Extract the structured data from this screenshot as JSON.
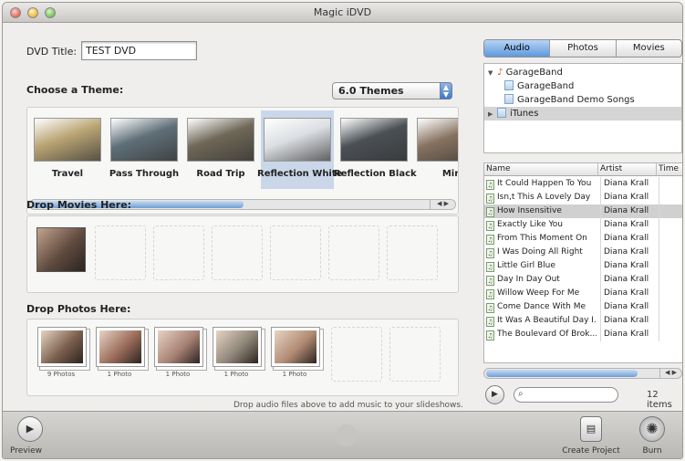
{
  "window": {
    "title": "Magic iDVD"
  },
  "dvd": {
    "label": "DVD Title:",
    "value": "TEST DVD"
  },
  "themes": {
    "heading": "Choose a Theme:",
    "selector_value": "6.0 Themes",
    "items": [
      {
        "label": "Travel",
        "color": "#b9a473"
      },
      {
        "label": "Pass Through",
        "color": "#5f6f78"
      },
      {
        "label": "Road Trip",
        "color": "#6f6757"
      },
      {
        "label": "Reflection White",
        "color": "#dcdfe3"
      },
      {
        "label": "Reflection Black",
        "color": "#4b5055"
      },
      {
        "label": "Mir",
        "color": "#86725f"
      }
    ],
    "selected_index": 3,
    "scroll_position": 0.55
  },
  "movies": {
    "heading": "Drop Movies Here:"
  },
  "photos": {
    "heading": "Drop Photos Here:",
    "items": [
      {
        "count": "9 Photos",
        "color": "#7b5f4d"
      },
      {
        "count": "1 Photo",
        "color": "#9a6b5a"
      },
      {
        "count": "1 Photo",
        "color": "#a88275"
      },
      {
        "count": "1 Photo",
        "color": "#8e8578"
      },
      {
        "count": "1 Photo",
        "color": "#b08a73"
      }
    ],
    "hint": "Drop audio files above to add music to your slideshows."
  },
  "media": {
    "tabs": [
      "Audio",
      "Photos",
      "Movies"
    ],
    "active_tab": "Audio",
    "sources": [
      {
        "label": "GarageBand",
        "level": 0,
        "expanded": true
      },
      {
        "label": "GarageBand",
        "level": 1
      },
      {
        "label": "GarageBand Demo Songs",
        "level": 1
      },
      {
        "label": "iTunes",
        "level": 0,
        "expanded": false,
        "selected": true
      }
    ],
    "columns": [
      "Name",
      "Artist",
      "Time"
    ],
    "tracks": [
      {
        "name": "It Could Happen To You",
        "artist": "Diana Krall"
      },
      {
        "name": "Isn,t This A Lovely Day",
        "artist": "Diana Krall"
      },
      {
        "name": "How Insensitive",
        "artist": "Diana Krall"
      },
      {
        "name": "Exactly Like You",
        "artist": "Diana Krall"
      },
      {
        "name": "From This Moment On",
        "artist": "Diana Krall"
      },
      {
        "name": "I Was Doing All Right",
        "artist": "Diana Krall"
      },
      {
        "name": "Little Girl Blue",
        "artist": "Diana Krall"
      },
      {
        "name": "Day In Day Out",
        "artist": "Diana Krall"
      },
      {
        "name": "Willow Weep For Me",
        "artist": "Diana Krall"
      },
      {
        "name": "Come Dance With Me",
        "artist": "Diana Krall"
      },
      {
        "name": "It Was A Beautiful Day I...",
        "artist": "Diana Krall"
      },
      {
        "name": "The Boulevard Of Brok...",
        "artist": "Diana Krall"
      }
    ],
    "selected_track_index": 2,
    "search_placeholder": "",
    "item_count": "12 items"
  },
  "toolbar": {
    "preview": "Preview",
    "create_project": "Create Project",
    "burn": "Burn"
  }
}
